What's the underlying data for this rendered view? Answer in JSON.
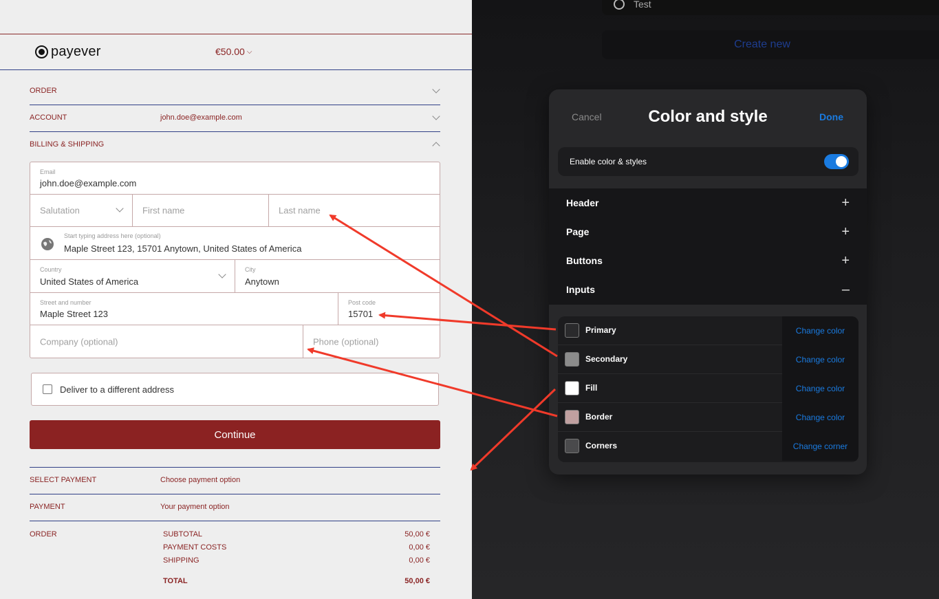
{
  "checkout": {
    "logo": "payever",
    "amount": "€50.00",
    "sections": {
      "order_label": "ORDER",
      "account_label": "ACCOUNT",
      "account_value": "john.doe@example.com",
      "billing_label": "BILLING & SHIPPING"
    },
    "form": {
      "email_label": "Email",
      "email_value": "john.doe@example.com",
      "salutation_placeholder": "Salutation",
      "first_name_placeholder": "First name",
      "last_name_placeholder": "Last name",
      "address_label": "Start typing address here (optional)",
      "address_value": "Maple Street 123, 15701 Anytown, United States of America",
      "country_label": "Country",
      "country_value": "United States of America",
      "city_label": "City",
      "city_value": "Anytown",
      "street_label": "Street and number",
      "street_value": "Maple Street 123",
      "postcode_label": "Post code",
      "postcode_value": "15701",
      "company_placeholder": "Company (optional)",
      "phone_placeholder": "Phone (optional)"
    },
    "deliver_label": "Deliver to a different address",
    "continue_label": "Continue",
    "select_payment_label": "SELECT PAYMENT",
    "select_payment_value": "Choose payment option",
    "payment_label": "PAYMENT",
    "payment_value": "Your payment option",
    "order_summary_label": "ORDER",
    "summary": [
      {
        "label": "SUBTOTAL",
        "value": "50,00 €"
      },
      {
        "label": "PAYMENT COSTS",
        "value": "0,00 €"
      },
      {
        "label": "SHIPPING",
        "value": "0,00 €"
      }
    ],
    "total": {
      "label": "TOTAL",
      "value": "50,00 €"
    }
  },
  "editor": {
    "top_item": "Test",
    "create_new": "Create new",
    "modal": {
      "cancel": "Cancel",
      "title": "Color and style",
      "done": "Done",
      "enable_label": "Enable color & styles",
      "enable_on": true,
      "categories": [
        {
          "label": "Header",
          "symbol": "+"
        },
        {
          "label": "Page",
          "symbol": "+"
        },
        {
          "label": "Buttons",
          "symbol": "+"
        },
        {
          "label": "Inputs",
          "symbol": "–"
        }
      ],
      "inputs": [
        {
          "label": "Primary",
          "swatch": "#2a2a2c",
          "action": "Change color"
        },
        {
          "label": "Secondary",
          "swatch": "#8c8c8c",
          "action": "Change color"
        },
        {
          "label": "Fill",
          "swatch": "#ffffff",
          "action": "Change color"
        },
        {
          "label": "Border",
          "swatch": "#c0a0a0",
          "action": "Change color"
        },
        {
          "label": "Corners",
          "swatch": "#4a4a4c",
          "action": "Change corner"
        }
      ]
    }
  },
  "colors": {
    "brand_red": "#8b2222",
    "accent_blue": "#1a7be0",
    "divider_blue": "#2f3f86",
    "arrow_red": "#f03a2a"
  }
}
